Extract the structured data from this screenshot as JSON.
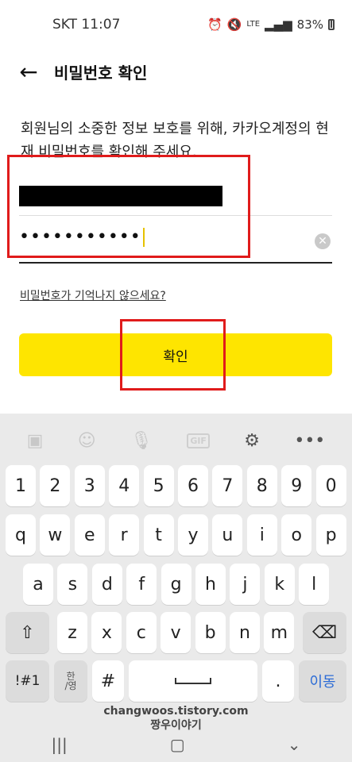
{
  "status_bar": {
    "carrier_time": "SKT 11:07",
    "lte_label": "LTE",
    "battery_percent": "83%"
  },
  "app_bar": {
    "title": "비밀번호 확인"
  },
  "description": "회원님의 소중한 정보 보호를 위해, 카카오계정의 현재 비밀번호를 확인해 주세요.",
  "password_field": {
    "value": "•••••••••••"
  },
  "forgot_link": "비밀번호가 기억나지 않으세요?",
  "confirm_button": "확인",
  "keyboard": {
    "numbers": [
      "1",
      "2",
      "3",
      "4",
      "5",
      "6",
      "7",
      "8",
      "9",
      "0"
    ],
    "row1": [
      "q",
      "w",
      "e",
      "r",
      "t",
      "y",
      "u",
      "i",
      "o",
      "p"
    ],
    "row2": [
      "a",
      "s",
      "d",
      "f",
      "g",
      "h",
      "j",
      "k",
      "l"
    ],
    "row3": [
      "z",
      "x",
      "c",
      "v",
      "b",
      "n",
      "m"
    ],
    "symbols_key": "!#1",
    "lang_key_top": "한",
    "lang_key_bottom": "/영",
    "hash_key": "#",
    "period_key": ".",
    "action_key": "이동"
  },
  "watermark": {
    "line1": "changwoos.tistory.com",
    "line2": "짱우이야기"
  },
  "icons": {
    "back": "arrow-left-icon",
    "clear": "clear-circle-icon",
    "shift": "shift-icon",
    "backspace": "backspace-icon"
  },
  "colors": {
    "accent": "#fee500",
    "highlight": "#e01b1b",
    "action_key": "#2b6bd6"
  }
}
